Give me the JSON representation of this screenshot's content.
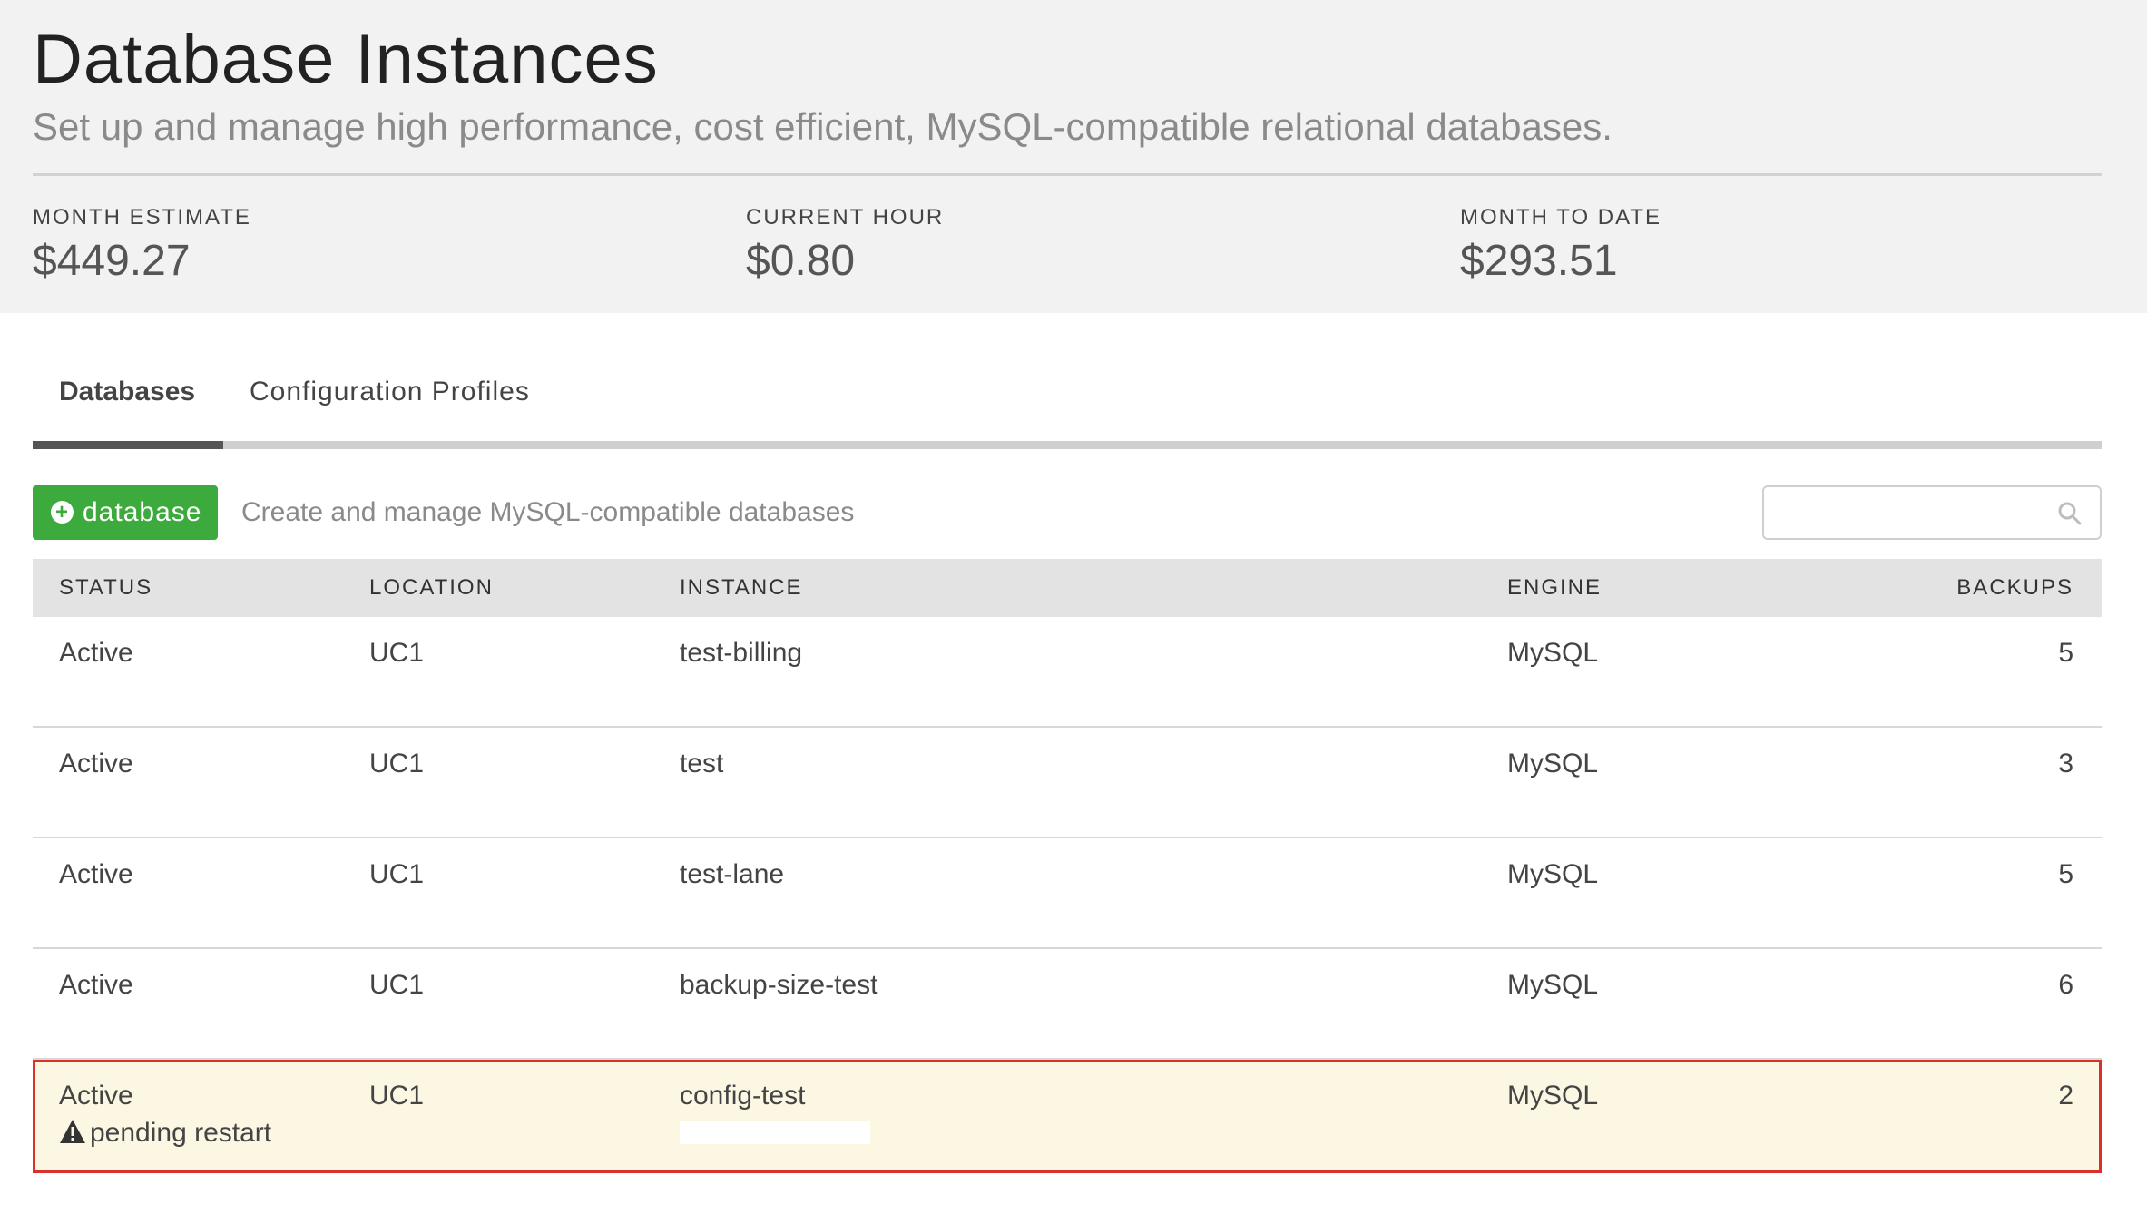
{
  "header": {
    "title": "Database Instances",
    "subtitle": "Set up and manage high performance, cost efficient, MySQL-compatible relational databases."
  },
  "stats": [
    {
      "label": "MONTH ESTIMATE",
      "value": "$449.27"
    },
    {
      "label": "CURRENT HOUR",
      "value": "$0.80"
    },
    {
      "label": "MONTH TO DATE",
      "value": "$293.51"
    }
  ],
  "tabs": [
    {
      "label": "Databases",
      "active": true
    },
    {
      "label": "Configuration Profiles",
      "active": false
    }
  ],
  "toolbar": {
    "add_label": "database",
    "description": "Create and manage MySQL-compatible databases",
    "search_placeholder": ""
  },
  "table": {
    "headers": {
      "status": "STATUS",
      "location": "LOCATION",
      "instance": "INSTANCE",
      "engine": "ENGINE",
      "backups": "BACKUPS"
    },
    "rows": [
      {
        "status": "Active",
        "location": "UC1",
        "instance": "test-billing",
        "engine": "MySQL",
        "backups": "5"
      },
      {
        "status": "Active",
        "location": "UC1",
        "instance": "test",
        "engine": "MySQL",
        "backups": "3"
      },
      {
        "status": "Active",
        "location": "UC1",
        "instance": "test-lane",
        "engine": "MySQL",
        "backups": "5"
      },
      {
        "status": "Active",
        "location": "UC1",
        "instance": "backup-size-test",
        "engine": "MySQL",
        "backups": "6"
      },
      {
        "status": "Active",
        "location": "UC1",
        "instance": "config-test",
        "engine": "MySQL",
        "backups": "2",
        "note": "pending restart"
      }
    ]
  },
  "colors": {
    "accent_green": "#3daa3d",
    "highlight_border": "#d9302b",
    "highlight_bg": "#fcf7e3"
  }
}
